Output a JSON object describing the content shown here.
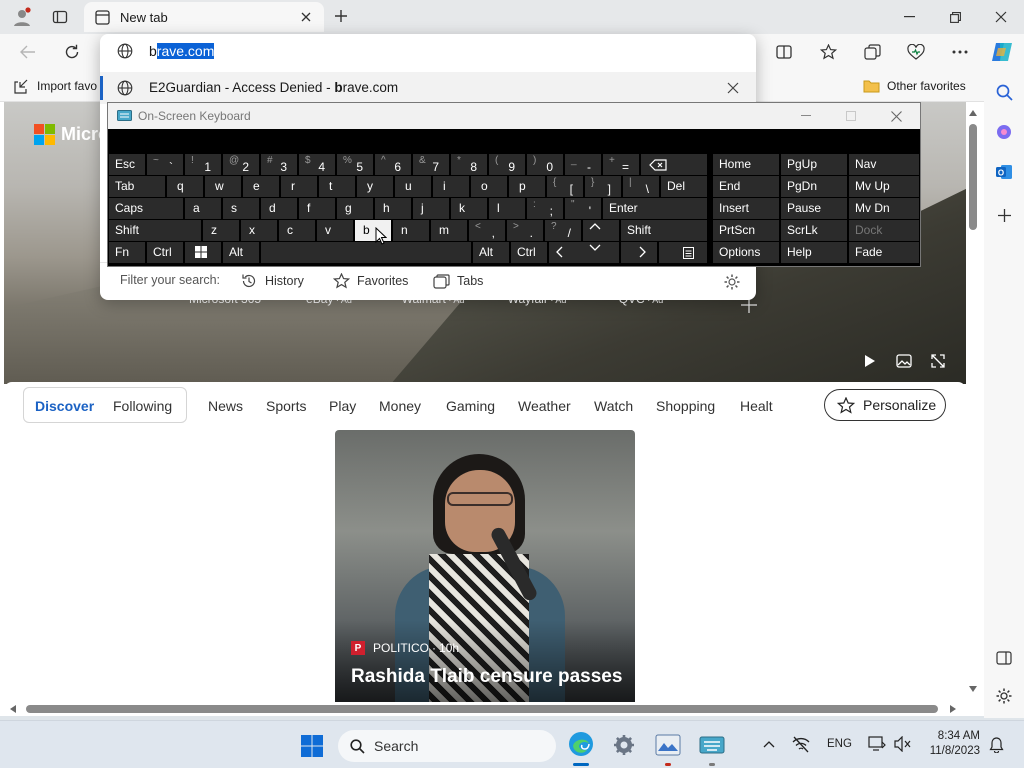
{
  "browser": {
    "tab_title": "New tab",
    "address": {
      "typed": "b",
      "completion": "rave.com"
    },
    "favorites": {
      "import_label": "Import favo",
      "other_label": "Other favorites"
    }
  },
  "omnibox": {
    "suggestion": {
      "title": "E2Guardian - Access Denied",
      "separator": " - ",
      "url_bold": "b",
      "url_rest": "rave.com"
    },
    "filter": {
      "label": "Filter your search:",
      "history": "History",
      "favorites": "Favorites",
      "tabs": "Tabs"
    }
  },
  "newtab": {
    "brand": "Micro",
    "quicklinks": [
      {
        "label": "Microsoft 365",
        "ad": ""
      },
      {
        "label": "eBay",
        "ad": "Ad"
      },
      {
        "label": "Walmart",
        "ad": "Ad"
      },
      {
        "label": "Wayfair",
        "ad": "Ad"
      },
      {
        "label": "QVC",
        "ad": "Ad"
      }
    ],
    "nav": [
      "Discover",
      "Following",
      "News",
      "Sports",
      "Play",
      "Money",
      "Gaming",
      "Weather",
      "Watch",
      "Shopping",
      "Healt"
    ],
    "personalize": "Personalize",
    "story": {
      "source": "POLITICO",
      "age": "10h",
      "headline": "Rashida Tlaib censure passes"
    }
  },
  "osk": {
    "title": "On-Screen Keyboard",
    "keys": {
      "esc": "Esc",
      "tab": "Tab",
      "caps": "Caps",
      "shift": "Shift",
      "fn": "Fn",
      "ctrl": "Ctrl",
      "alt": "Alt",
      "del": "Del",
      "enter": "Enter",
      "row1": [
        [
          "~",
          "`"
        ],
        [
          "!",
          "1"
        ],
        [
          "@",
          "2"
        ],
        [
          "#",
          "3"
        ],
        [
          "$",
          "4"
        ],
        [
          "%",
          "5"
        ],
        [
          "^",
          "6"
        ],
        [
          "&",
          "7"
        ],
        [
          "*",
          "8"
        ],
        [
          "(",
          "9"
        ],
        [
          ")",
          "0"
        ],
        [
          "_",
          "-"
        ],
        [
          "+",
          "="
        ]
      ],
      "row2": [
        "q",
        "w",
        "e",
        "r",
        "t",
        "y",
        "u",
        "i",
        "o",
        "p"
      ],
      "row2p": [
        [
          "{",
          "["
        ],
        [
          "}",
          "]"
        ],
        [
          "|",
          "\\"
        ]
      ],
      "row3": [
        "a",
        "s",
        "d",
        "f",
        "g",
        "h",
        "j",
        "k",
        "l"
      ],
      "row3p": [
        [
          ":",
          ";"
        ],
        [
          "\"",
          "'"
        ]
      ],
      "row4": [
        "z",
        "x",
        "c",
        "v",
        "b",
        "n",
        "m"
      ],
      "row4p": [
        [
          "<",
          ","
        ],
        [
          ">",
          "."
        ],
        [
          "?",
          "/"
        ]
      ],
      "nav": [
        "Home",
        "PgUp",
        "Nav",
        "End",
        "PgDn",
        "Mv Up",
        "Insert",
        "Pause",
        "Mv Dn",
        "PrtScn",
        "ScrLk",
        "Dock",
        "Options",
        "Help",
        "Fade"
      ]
    }
  },
  "taskbar": {
    "search": "Search",
    "lang": "ENG",
    "time": "8:34 AM",
    "date": "11/8/2023"
  }
}
